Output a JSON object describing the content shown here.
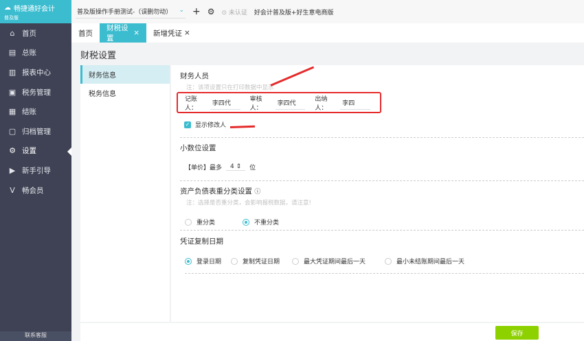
{
  "app": {
    "logo": "畅捷通好会计",
    "edition": "普及版",
    "book": "普及版操作手册测试-（误删勿动）",
    "cert": "未认证",
    "product": "好会计普及版+好生意电商版",
    "bottom": "联系客服"
  },
  "nav": [
    {
      "icon": "⌂",
      "label": "首页"
    },
    {
      "icon": "▤",
      "label": "总账"
    },
    {
      "icon": "▥",
      "label": "报表中心"
    },
    {
      "icon": "▣",
      "label": "税务管理"
    },
    {
      "icon": "▦",
      "label": "结账"
    },
    {
      "icon": "▢",
      "label": "归档管理"
    },
    {
      "icon": "⚙",
      "label": "设置"
    },
    {
      "icon": "▶",
      "label": "新手引导"
    },
    {
      "icon": "V",
      "label": "畅会员"
    }
  ],
  "tabs": [
    "首页",
    "财税设置",
    "新增凭证"
  ],
  "page_title": "财税设置",
  "left_menu": [
    "财务信息",
    "税务信息"
  ],
  "finance": {
    "title": "财务人员",
    "note": "注：该项设置只在打印数据中显示",
    "fields": [
      {
        "label": "记账人：",
        "value": "李四代"
      },
      {
        "label": "审核人：",
        "value": "李四代"
      },
      {
        "label": "出纳人：",
        "value": "李四"
      }
    ],
    "show_modifier": "显示修改人"
  },
  "decimal": {
    "title": "小数位设置",
    "prefix": "【单价】最多",
    "value": "4",
    "suffix": "位"
  },
  "reclass": {
    "title": "资产负债表重分类设置",
    "note": "注：选择是否重分类，会影响报税数据，请注意!",
    "options": [
      "重分类",
      "不重分类"
    ]
  },
  "copydate": {
    "title": "凭证复制日期",
    "options": [
      "登录日期",
      "复制凭证日期",
      "最大凭证期间最后一天",
      "最小未结账期间最后一天"
    ]
  },
  "save": "保存"
}
